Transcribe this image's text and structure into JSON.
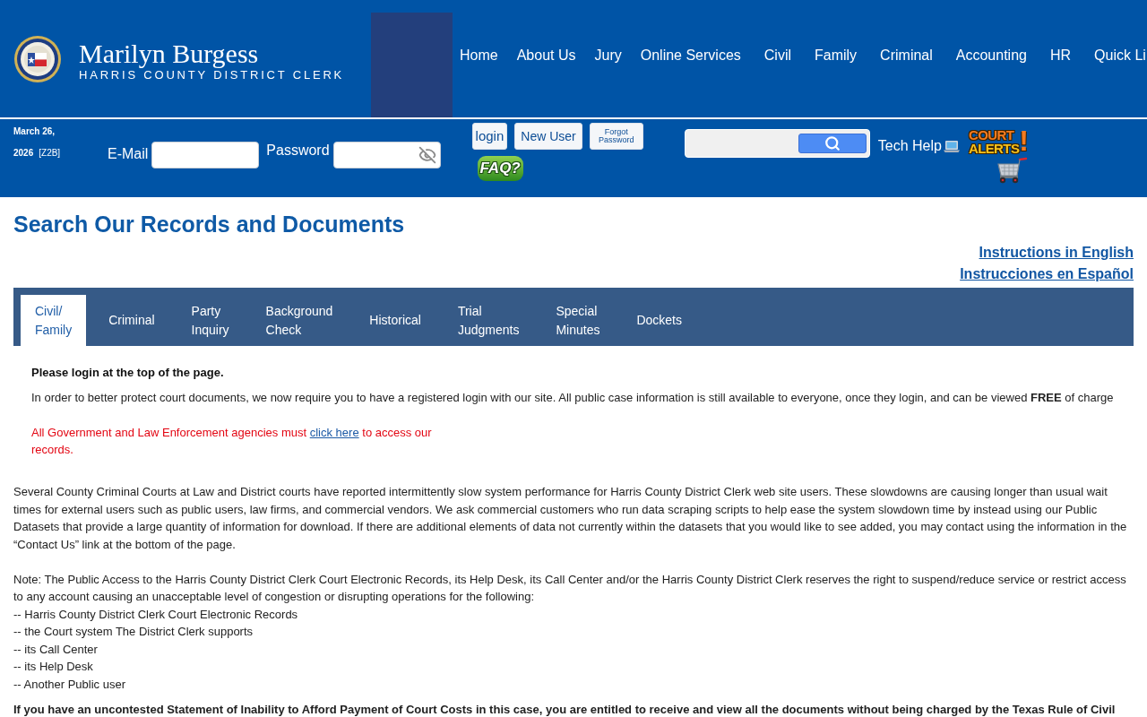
{
  "header": {
    "title": "Marilyn Burgess",
    "subtitle": "HARRIS COUNTY DISTRICT CLERK"
  },
  "nav": {
    "items": [
      "Home",
      "About Us",
      "Jury",
      "Online Services",
      "Civil",
      "Family",
      "Criminal",
      "Accounting",
      "HR",
      "Quick Li"
    ]
  },
  "login_bar": {
    "date": "March 26, 2026",
    "code": "[Z2B]",
    "email_label": "E-Mail",
    "password_label": "Password",
    "buttons": [
      {
        "kind": "large",
        "label": "login"
      },
      {
        "kind": "medium",
        "label": "New User"
      },
      {
        "kind": "small",
        "label": "Forgot Password"
      }
    ],
    "faq": "FAQ?",
    "tech_help": "Tech Help",
    "court_alerts": {
      "lines": [
        "COURT",
        "ALERTS"
      ],
      "mark": "!"
    }
  },
  "page": {
    "title": "Search Our Records and Documents",
    "links": [
      "Instructions in English",
      "Instrucciones en Español"
    ]
  },
  "tabs": [
    {
      "lines": [
        "Civil/",
        "Family"
      ],
      "selected": true
    },
    {
      "lines": [
        "Criminal"
      ],
      "selected": false
    },
    {
      "lines": [
        "Party",
        "Inquiry"
      ],
      "selected": false
    },
    {
      "lines": [
        "Background",
        "Check"
      ],
      "selected": false
    },
    {
      "lines": [
        "Historical"
      ],
      "selected": false
    },
    {
      "lines": [
        "Trial",
        "Judgments"
      ],
      "selected": false
    },
    {
      "lines": [
        "Special",
        "Minutes"
      ],
      "selected": false
    },
    {
      "lines": [
        "Dockets"
      ],
      "selected": false
    }
  ],
  "panel": {
    "heading": "Please login at the top of the page.",
    "text": "In order to better protect court documents, we now require you to have a registered login with our site. All public case information is still available to everyone, once they login, and can be viewed **FREE** of charge",
    "agency_notice": {
      "before": "All Government and Law Enforcement agencies must",
      "link": "click here",
      "after": "to access our records."
    }
  },
  "notices": {
    "slowdown": "Several County Criminal Courts at Law and District courts have reported intermittently slow system performance for Harris County District Clerk web site users. These slowdowns are causing longer than usual wait times for external users such as public users, law firms, and commercial vendors. We ask commercial customers who run data scraping scripts to help ease the system slowdown time by instead using our Public Datasets that provide a large quantity of information for download. If there are additional elements of data not currently within the datasets that you would like to see added, you may contact using the information in the “Contact Us” link at the bottom of the page.",
    "note": "Note: The Public Access to the Harris County District Clerk Court Electronic Records, its Help Desk, its Call Center and/or the Harris County District Clerk reserves the right to suspend/reduce service or restrict access to any account causing an unacceptable level of congestion or disrupting operations for the following:",
    "note_items": [
      "-- Harris County District Clerk Court Electronic Records",
      "-- the Court system The District Clerk supports",
      "-- its Call Center",
      "-- its Help Desk",
      "-- Another Public user"
    ],
    "fee_notice": "If you have an uncontested Statement of Inability to Afford Payment of Court Costs in this case, you are entitled to receive and view all the documents without being charged by the Texas Rule of Civil"
  }
}
